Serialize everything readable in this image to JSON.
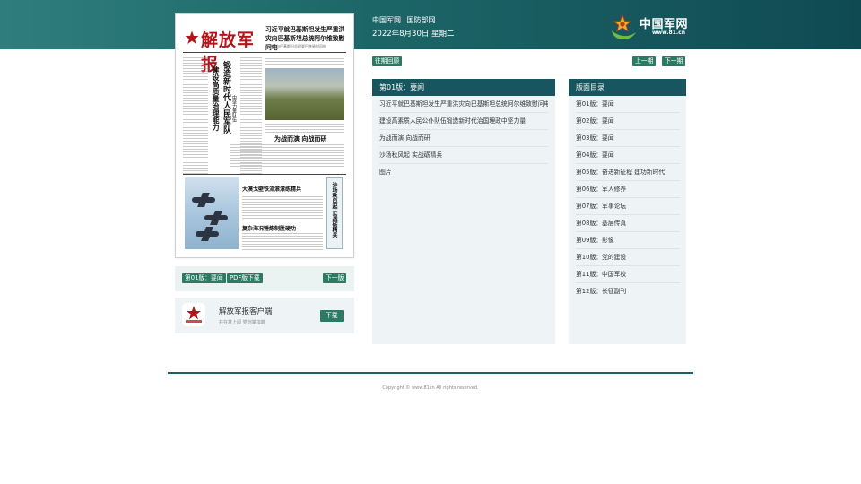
{
  "header": {
    "links": [
      "中国军网",
      "国防部网"
    ],
    "date": "2022年8月30日 星期二",
    "logo_text": "中国军网",
    "logo_url": "www.81.cn"
  },
  "newspaper": {
    "masthead": "解放军报",
    "headline": "习近平就巴基斯坦发生严重洪灾向巴基斯坦总统阿尔维致慰问电",
    "subline": "李克强向巴基斯坦总理夏巴兹致慰问电",
    "vertical_title_1": "锻造新时代人民军队",
    "vertical_title_2": "建设高质量治理能力",
    "vertical_title_3": "中坚力量队伍",
    "mid_heading": "为战而演 向战而研",
    "lower_heading_1": "大漠戈壁铁流滚滚练精兵",
    "lower_heading_2": "复杂海况锤炼制胜硬功",
    "side_box_text": "沙场秋风起 实战砺精兵"
  },
  "paper_nav": {
    "current_page": "第01版：要闻",
    "pdf_label": "PDF版下载",
    "next_label": "下一版"
  },
  "app_promo": {
    "title": "解放军报客户端",
    "subtitle": "共在掌上阅 党创掌指端",
    "download_label": "下载"
  },
  "nav": {
    "archive_label": "往期回顾",
    "prev_label": "上一期",
    "next_label": "下一期"
  },
  "articles": {
    "heading": "第01版：要闻",
    "items": [
      "习近平就巴基斯坦发生严重洪灾向巴基斯坦总统阿尔维致慰问电",
      "建设高素质人民公仆队伍锻造新时代治国理政中坚力量",
      "为战而演 向战而研",
      "沙场秋风起 实战砺精兵",
      "图片"
    ]
  },
  "pages": {
    "heading": "版面目录",
    "items": [
      "第01版：要闻",
      "第02版：要闻",
      "第03版：要闻",
      "第04版：要闻",
      "第05版：奋进新征程 建功新时代",
      "第06版：军人修养",
      "第07版：军事论坛",
      "第08版：基层传真",
      "第09版：影像",
      "第10版：党的建设",
      "第11版：中国军校",
      "第12版：长征副刊"
    ]
  },
  "footer": {
    "copyright": "Copyright © www.81cn All rights reserved."
  },
  "colors": {
    "header_start": "#2f7e7d",
    "header_end": "#0f4a53",
    "section_head": "#17565e",
    "tag_green": "#2a7b62",
    "masthead_red": "#b3141b"
  }
}
